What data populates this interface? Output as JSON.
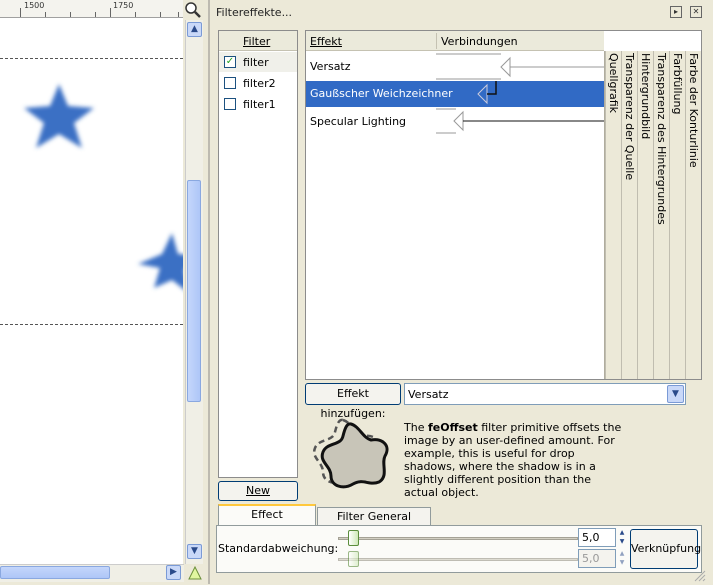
{
  "ruler": {
    "label_1500": "1500",
    "label_1750": "1750"
  },
  "dialog": {
    "title": "Filtereffekte...",
    "filter_column_header": "Filter",
    "filters": [
      {
        "label": "filter",
        "checked": true
      },
      {
        "label": "filter2",
        "checked": false
      },
      {
        "label": "filter1",
        "checked": false
      }
    ],
    "new_button": "New",
    "effects_header": {
      "effect": "Effekt",
      "connections": "Verbindungen"
    },
    "effects": [
      {
        "label": "Versatz",
        "selected": false
      },
      {
        "label": "Gaußscher Weichzeichner",
        "selected": true
      },
      {
        "label": "Specular Lighting",
        "selected": false
      }
    ],
    "input_sources": [
      "Quellgrafik",
      "Transparenz der Quelle",
      "Hintergrundbild",
      "Transparenz des Hintergrundes",
      "Farbfüllung",
      "Farbe der Konturlinie"
    ],
    "add_effect_button": "Effekt hinzufügen:",
    "add_effect_select": "Versatz",
    "description": {
      "prefix": "The ",
      "keyword": "feOffset",
      "text": " filter primitive offsets the image by an user-defined amount. For example, this is useful for drop shadows, where the shadow is in a slightly different position than the actual object."
    },
    "tabs": [
      "Effect parameters",
      "Filter General Settings"
    ],
    "std_deviation_label": "Standardabweichung:",
    "std_value_1": "5,0",
    "std_value_2": "5,0",
    "link_button": "Verknüpfung"
  },
  "colors": {
    "selection": "#316ac5",
    "star_fill": "#3a6fc4",
    "window_bg": "#ece9d8"
  }
}
